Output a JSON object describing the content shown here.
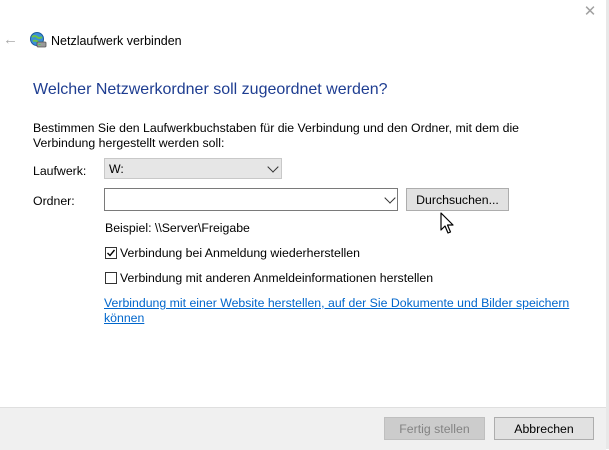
{
  "window": {
    "title": "Netzlaufwerk verbinden",
    "close_glyph": "✕",
    "back_glyph": "←"
  },
  "main": {
    "heading": "Welcher Netzwerkordner soll zugeordnet werden?",
    "instruction": "Bestimmen Sie den Laufwerkbuchstaben für die Verbindung und den Ordner, mit dem die Verbindung hergestellt werden soll:",
    "drive": {
      "label": "Laufwerk:",
      "value": "W:"
    },
    "folder": {
      "label": "Ordner:",
      "value": ""
    },
    "browse_label": "Durchsuchen...",
    "example": "Beispiel: \\\\Server\\Freigabe",
    "reconnect": {
      "label": "Verbindung bei Anmeldung wiederherstellen",
      "checked": true
    },
    "other_credentials": {
      "label": "Verbindung mit anderen Anmeldeinformationen herstellen",
      "checked": false
    },
    "website_link": "Verbindung mit einer Website herstellen, auf der Sie Dokumente und Bilder speichern können"
  },
  "footer": {
    "finish_label": "Fertig stellen",
    "cancel_label": "Abbrechen"
  },
  "colors": {
    "heading": "#1e3d91",
    "link": "#0066cc",
    "footer_bg": "#f0f0f0"
  },
  "icons": [
    "back-arrow-icon",
    "network-drive-icon",
    "close-icon",
    "chevron-down-icon",
    "checkmark-icon",
    "mouse-cursor-icon"
  ]
}
